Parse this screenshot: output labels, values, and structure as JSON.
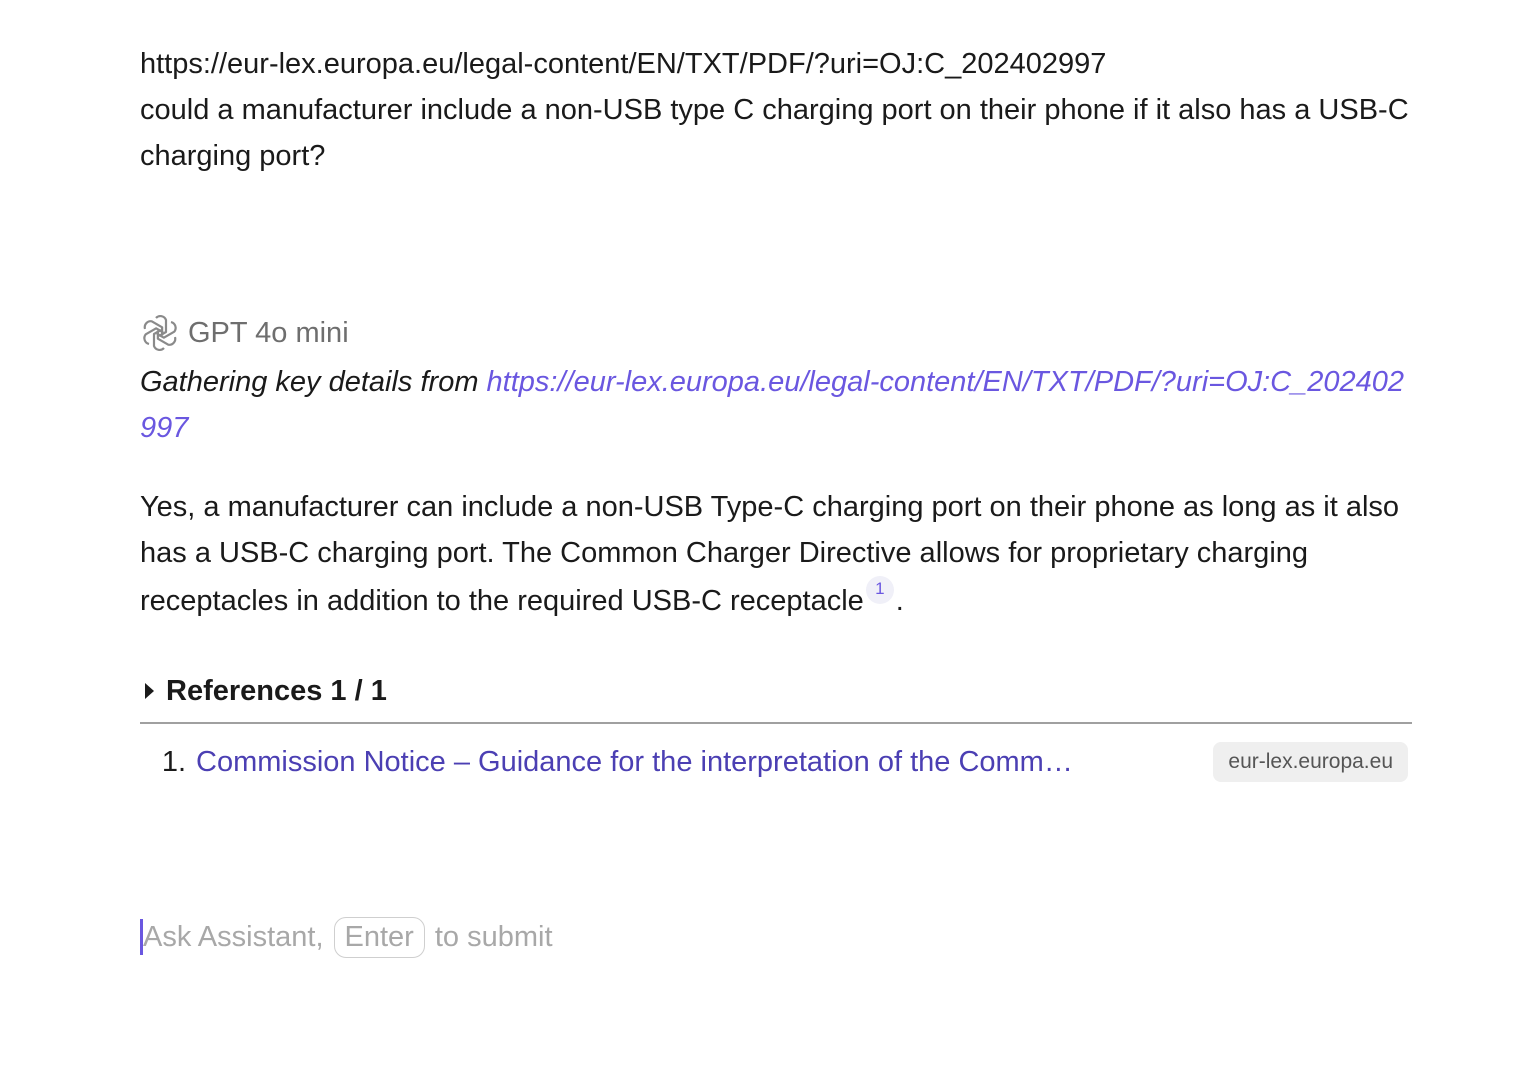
{
  "user_message": {
    "url": "https://eur-lex.europa.eu/legal-content/EN/TXT/PDF/?uri=OJ:C_202402997",
    "question": "could a manufacturer include a non-USB type C charging port on their phone if it also has a USB-C charging port?"
  },
  "assistant": {
    "model_icon": "openai-logo-icon",
    "model_name": "GPT 4o mini",
    "gathering_prefix": "Gathering key details from ",
    "gathering_link": "https://eur-lex.europa.eu/legal-content/EN/TXT/PDF/?uri=OJ:C_202402997",
    "answer_text": "Yes, a manufacturer can include a non-USB Type-C charging port on their phone as long as it also has a USB-C charging port. The Common Charger Directive allows for proprietary charging receptacles in addition to the required USB-C receptacle",
    "citation": "1",
    "answer_end": "."
  },
  "references": {
    "header": "References 1 / 1",
    "items": [
      {
        "num": "1.",
        "title": "Commission Notice – Guidance for the interpretation of the Comm…",
        "domain": "eur-lex.europa.eu"
      }
    ]
  },
  "input": {
    "placeholder_prefix": "Ask Assistant,",
    "enter_key": "Enter",
    "placeholder_suffix": "to submit"
  },
  "colors": {
    "accent": "#6a57e0",
    "link": "#4b3fb3",
    "muted": "#a8a8a8"
  }
}
